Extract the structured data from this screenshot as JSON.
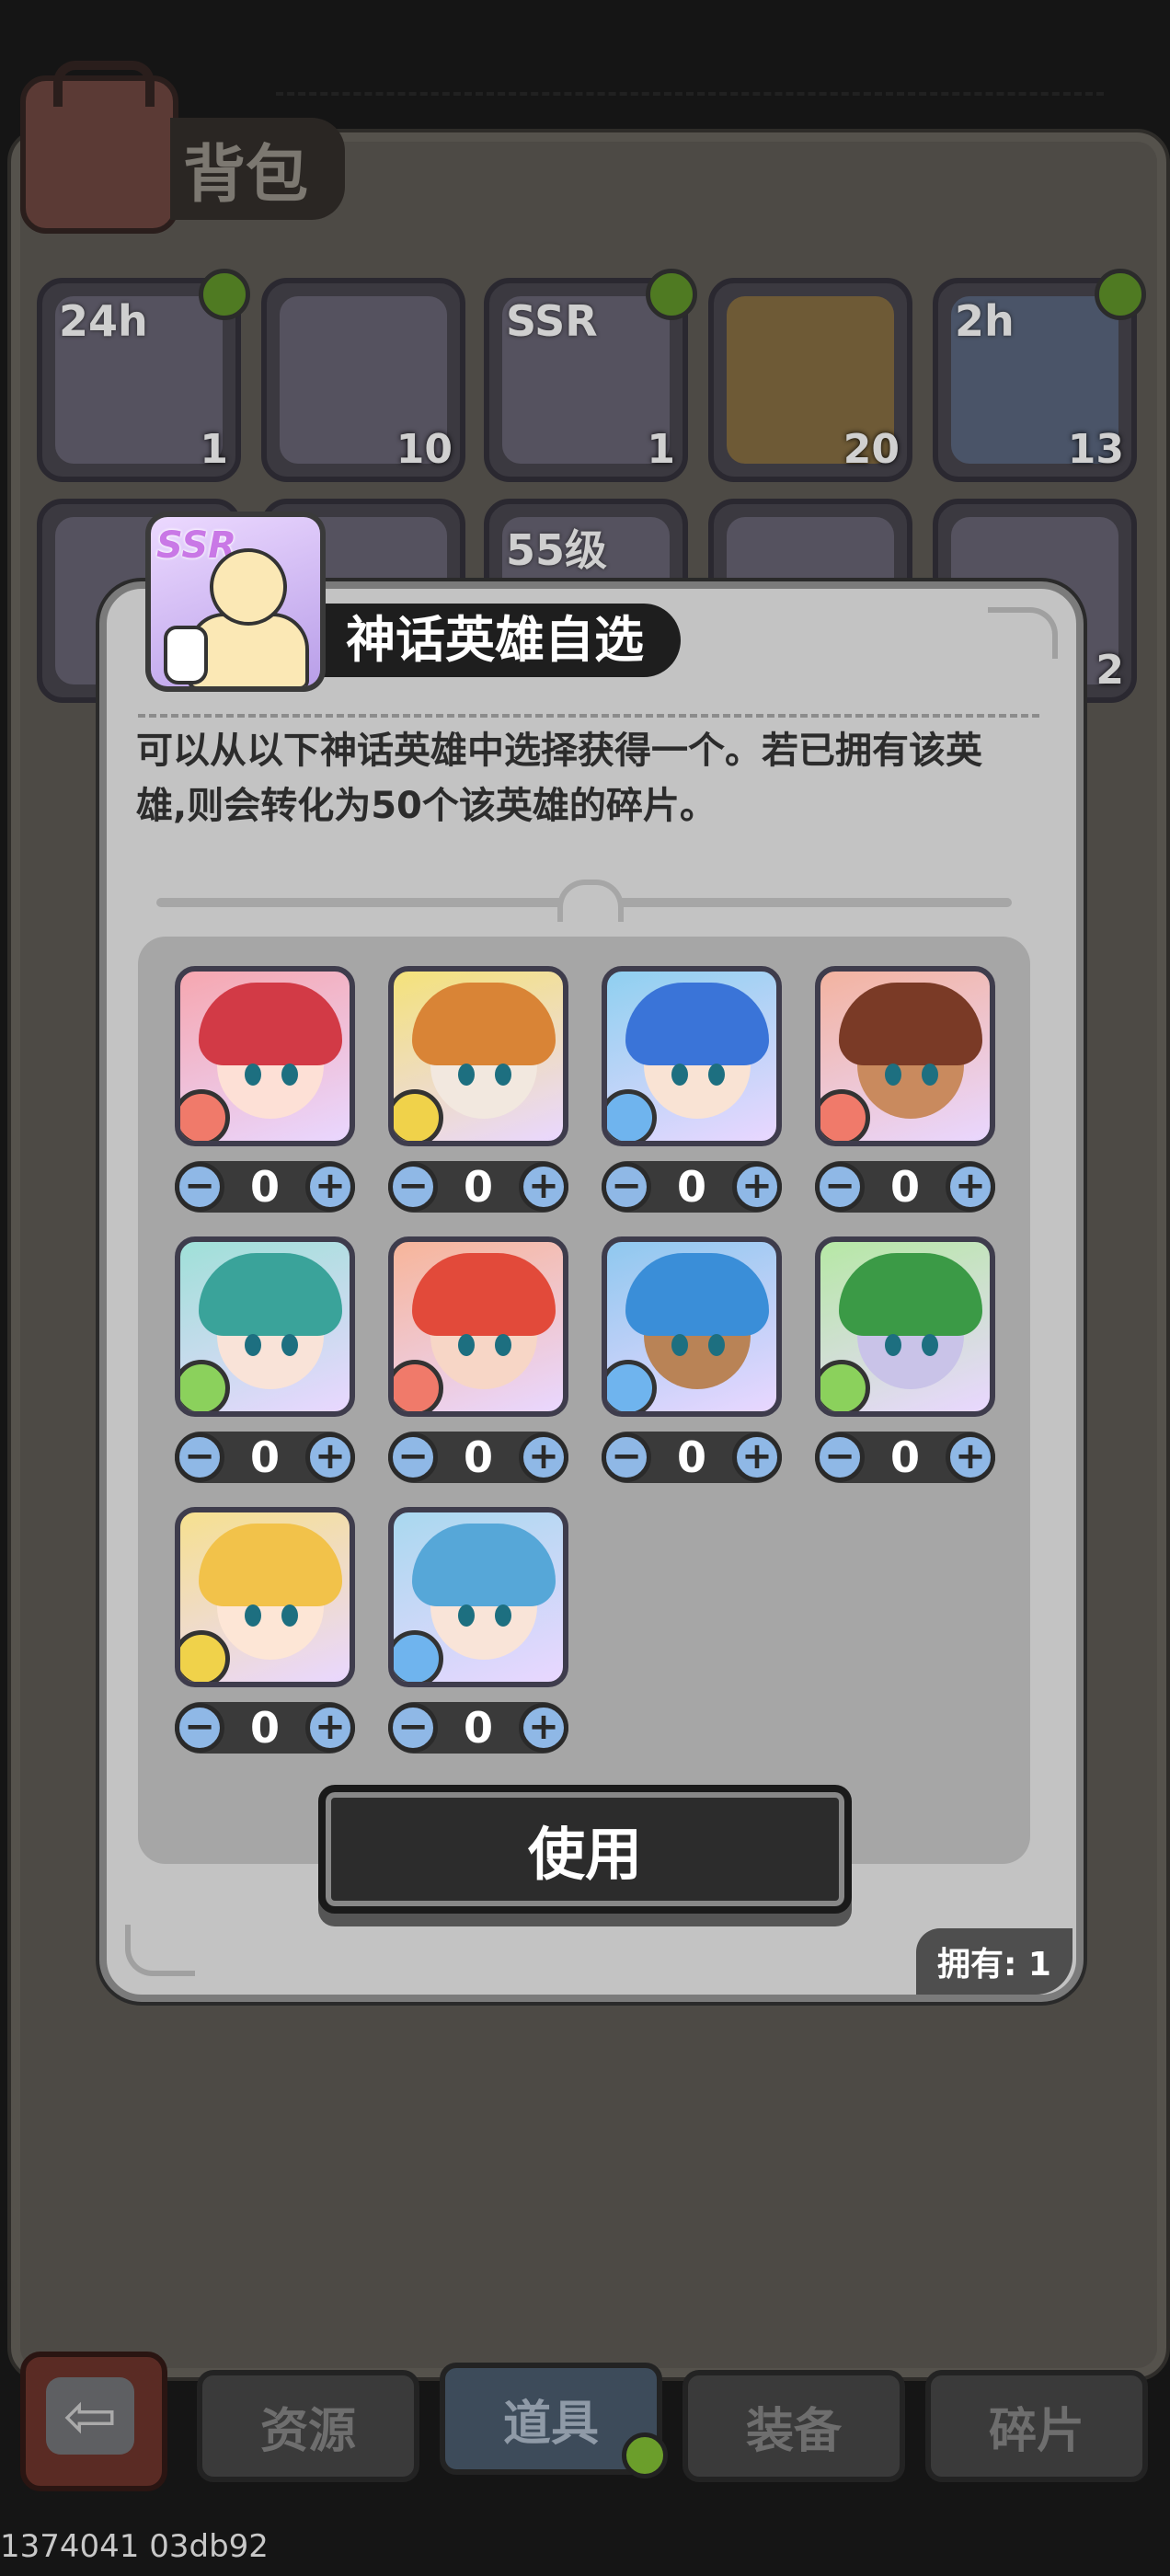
{
  "screen": {
    "title": "背包",
    "slots_row1": [
      {
        "label": "24h",
        "count": "1"
      },
      {
        "label": "",
        "count": "10"
      },
      {
        "label": "SSR",
        "count": "1"
      },
      {
        "label": "",
        "count": "20"
      },
      {
        "label": "2h",
        "count": "13"
      }
    ],
    "slots_row2": [
      {
        "label": "",
        "count": ""
      },
      {
        "label": "",
        "count": ""
      },
      {
        "label": "55级",
        "count": ""
      },
      {
        "label": "",
        "count": ""
      },
      {
        "label": "",
        "count": "2"
      }
    ]
  },
  "dialog": {
    "item_badge": "SSR",
    "title": "神话英雄自选",
    "description": "可以从以下神话英雄中选择获得一个。若已拥有该英雄,则会转化为50个该英雄的碎片。",
    "heroes": [
      {
        "value": "0",
        "element": "fire",
        "bg": "#f6a7b0",
        "hair": "#d23a46",
        "face": "#fde0d6"
      },
      {
        "value": "0",
        "element": "earth",
        "bg": "#f4e27a",
        "hair": "#d98436",
        "face": "#f2e8df"
      },
      {
        "value": "0",
        "element": "water",
        "bg": "#8fd0f0",
        "hair": "#3a74d8",
        "face": "#f9e3d4"
      },
      {
        "value": "0",
        "element": "fire",
        "bg": "#f3b3a0",
        "hair": "#7a3a26",
        "face": "#c98a5e"
      },
      {
        "value": "0",
        "element": "wind",
        "bg": "#9fe0d8",
        "hair": "#3aa39a",
        "face": "#f9e3d8"
      },
      {
        "value": "0",
        "element": "fire",
        "bg": "#f7b59a",
        "hair": "#e24a3a",
        "face": "#f7d6c6"
      },
      {
        "value": "0",
        "element": "water",
        "bg": "#8fc8ef",
        "hair": "#3a8ed8",
        "face": "#b98356"
      },
      {
        "value": "0",
        "element": "wind",
        "bg": "#b6e8a5",
        "hair": "#3b9a46",
        "face": "#c9c3e8"
      },
      {
        "value": "0",
        "element": "earth",
        "bg": "#f6e08f",
        "hair": "#f2c24a",
        "face": "#fde6d6"
      },
      {
        "value": "0",
        "element": "water",
        "bg": "#a9d8ef",
        "hair": "#56a7d8",
        "face": "#f9e4d8"
      }
    ],
    "minus_symbol": "−",
    "plus_symbol": "+",
    "use_label": "使用",
    "owned_label": "拥有: 1"
  },
  "tabs": [
    "资源",
    "道具",
    "装备",
    "碎片"
  ],
  "back_symbol": "⇦",
  "footer_text": "1374041 03db92",
  "colors": {
    "fire": "#f07a6a",
    "earth": "#f0d24a",
    "water": "#6fb4ee",
    "wind": "#8bd15c",
    "stepper_button": "#8fb8e6"
  }
}
